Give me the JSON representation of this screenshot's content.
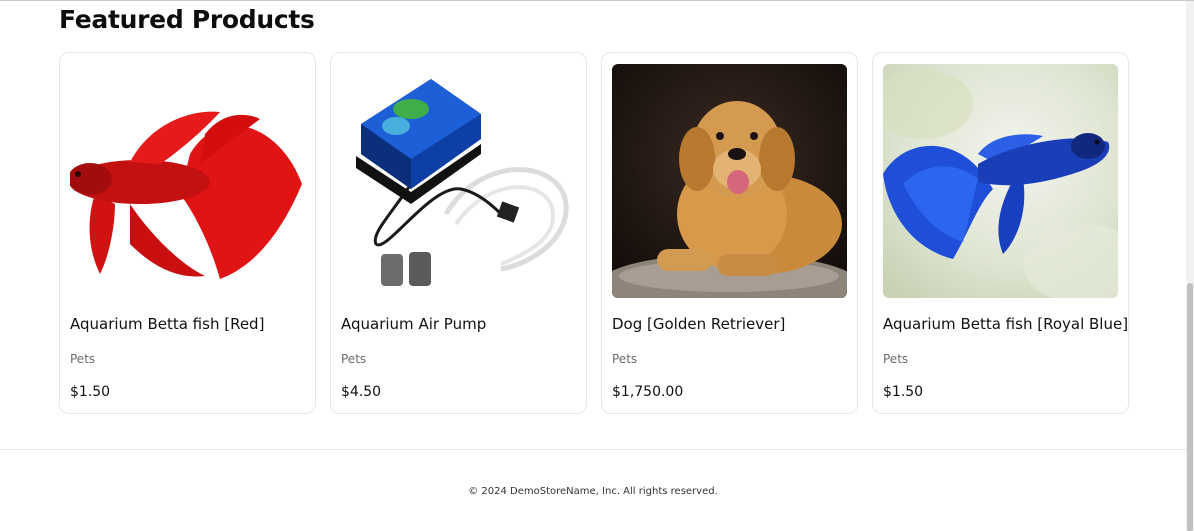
{
  "section": {
    "title": "Featured Products"
  },
  "products": [
    {
      "name": "Aquarium Betta fish [Red]",
      "category": "Pets",
      "price": "$1.50"
    },
    {
      "name": "Aquarium Air Pump",
      "category": "Pets",
      "price": "$4.50"
    },
    {
      "name": "Dog [Golden Retriever]",
      "category": "Pets",
      "price": "$1,750.00"
    },
    {
      "name": "Aquarium Betta fish [Royal Blue]",
      "category": "Pets",
      "price": "$1.50"
    }
  ],
  "footer": {
    "copyright": "© 2024 DemoStoreName, Inc. All rights reserved."
  },
  "colors": {
    "card_border": "#e6e6e6",
    "text_primary": "#111111",
    "text_muted": "#6b6b6b"
  }
}
